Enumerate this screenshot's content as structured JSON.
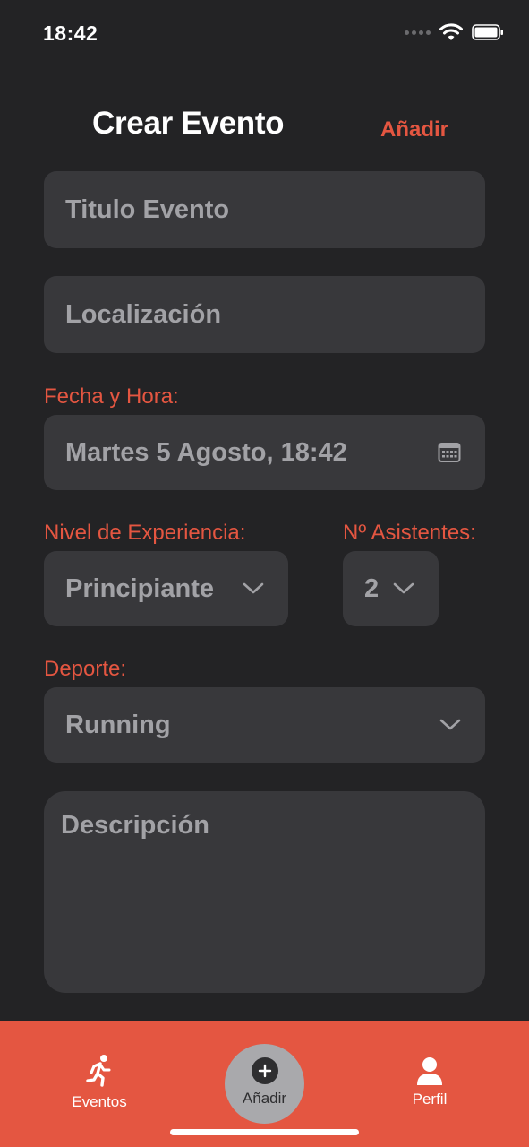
{
  "status_bar": {
    "time": "18:42"
  },
  "header": {
    "title": "Crear Evento",
    "action_label": "Añadir"
  },
  "form": {
    "title_placeholder": "Titulo Evento",
    "location_placeholder": "Localización",
    "datetime": {
      "label": "Fecha y Hora:",
      "value": "Martes 5 Agosto, 18:42"
    },
    "experience": {
      "label": "Nivel de Experiencia:",
      "value": "Principiante"
    },
    "attendees": {
      "label": "Nº Asistentes:",
      "value": "2"
    },
    "sport": {
      "label": "Deporte:",
      "value": "Running"
    },
    "description_placeholder": "Descripción"
  },
  "tab_bar": {
    "tabs": [
      {
        "label": "Eventos",
        "icon": "runner-icon"
      },
      {
        "label": "Añadir",
        "icon": "plus-circle-icon"
      },
      {
        "label": "Perfil",
        "icon": "person-icon"
      }
    ]
  },
  "colors": {
    "accent": "#e45641",
    "background": "#232325",
    "field": "#38383b",
    "placeholder": "#a2a2a6"
  }
}
